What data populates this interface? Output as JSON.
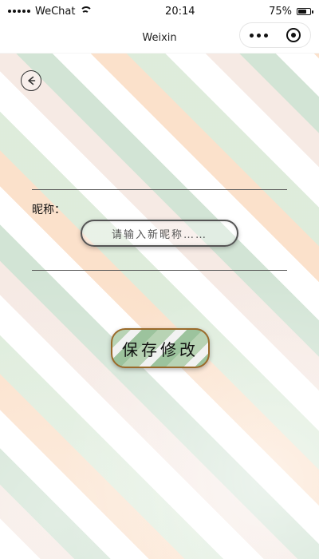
{
  "status_bar": {
    "carrier": "WeChat",
    "time": "20:14",
    "battery_percent": "75%",
    "battery_level": 0.75
  },
  "nav_bar": {
    "title": "Weixin"
  },
  "back": {
    "icon": "back-arrow-icon"
  },
  "form": {
    "nickname_label": "昵称：",
    "nickname_placeholder": "请输入新昵称……"
  },
  "actions": {
    "save_label": "保存修改"
  },
  "colors": {
    "accent_border": "#9a6a2a",
    "input_border": "#555555"
  }
}
